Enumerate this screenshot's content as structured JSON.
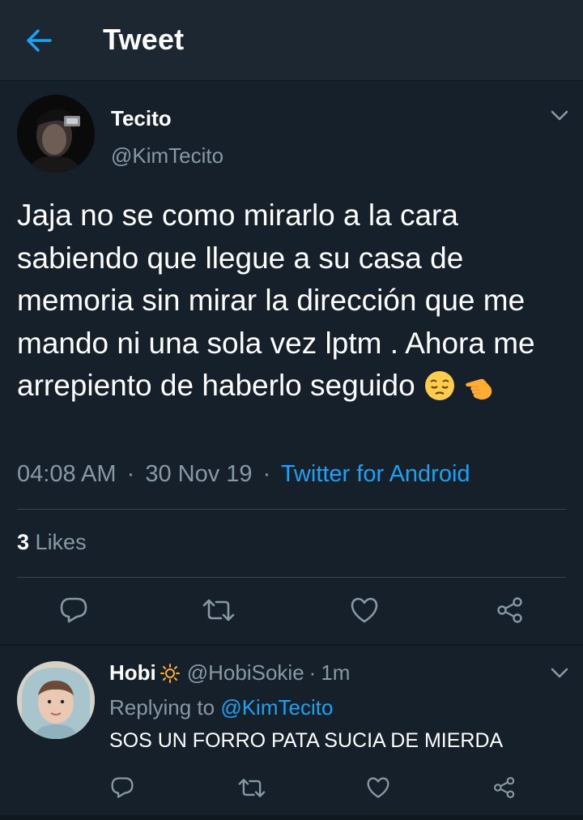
{
  "header": {
    "title": "Tweet",
    "back_icon": "arrow-left-icon"
  },
  "colors": {
    "background": "#15202b",
    "header_bg": "#1c2732",
    "accent": "#1da1f2",
    "secondary_text": "#8899a6",
    "divider": "#38444d"
  },
  "tweet": {
    "author_name": "Tecito",
    "author_handle": "@KimTecito",
    "text": "Jaja no se como mirarlo a la cara sabiendo que llegue a su casa de memoria sin mirar la dirección que me mando ni una sola vez lptm . Ahora me arrepiento de haberlo seguido",
    "emojis": [
      "pensive-face",
      "backhand-index-pointing-left"
    ],
    "time": "04:08 AM",
    "date": "30 Nov 19",
    "separator": "·",
    "source": "Twitter for Android",
    "likes_count": "3",
    "likes_label": "Likes",
    "actions": [
      "reply-icon",
      "retweet-icon",
      "like-icon",
      "share-icon"
    ]
  },
  "reply": {
    "author_name": "Hobi",
    "name_emoji": "sun-icon",
    "author_handle": "@HobiSokie",
    "separator": "·",
    "time": "1m",
    "replying_prefix": "Replying to",
    "replying_to": "@KimTecito",
    "text": "SOS UN FORRO PATA SUCIA DE MIERDA",
    "actions": [
      "reply-icon",
      "retweet-icon",
      "like-icon",
      "share-icon"
    ]
  }
}
